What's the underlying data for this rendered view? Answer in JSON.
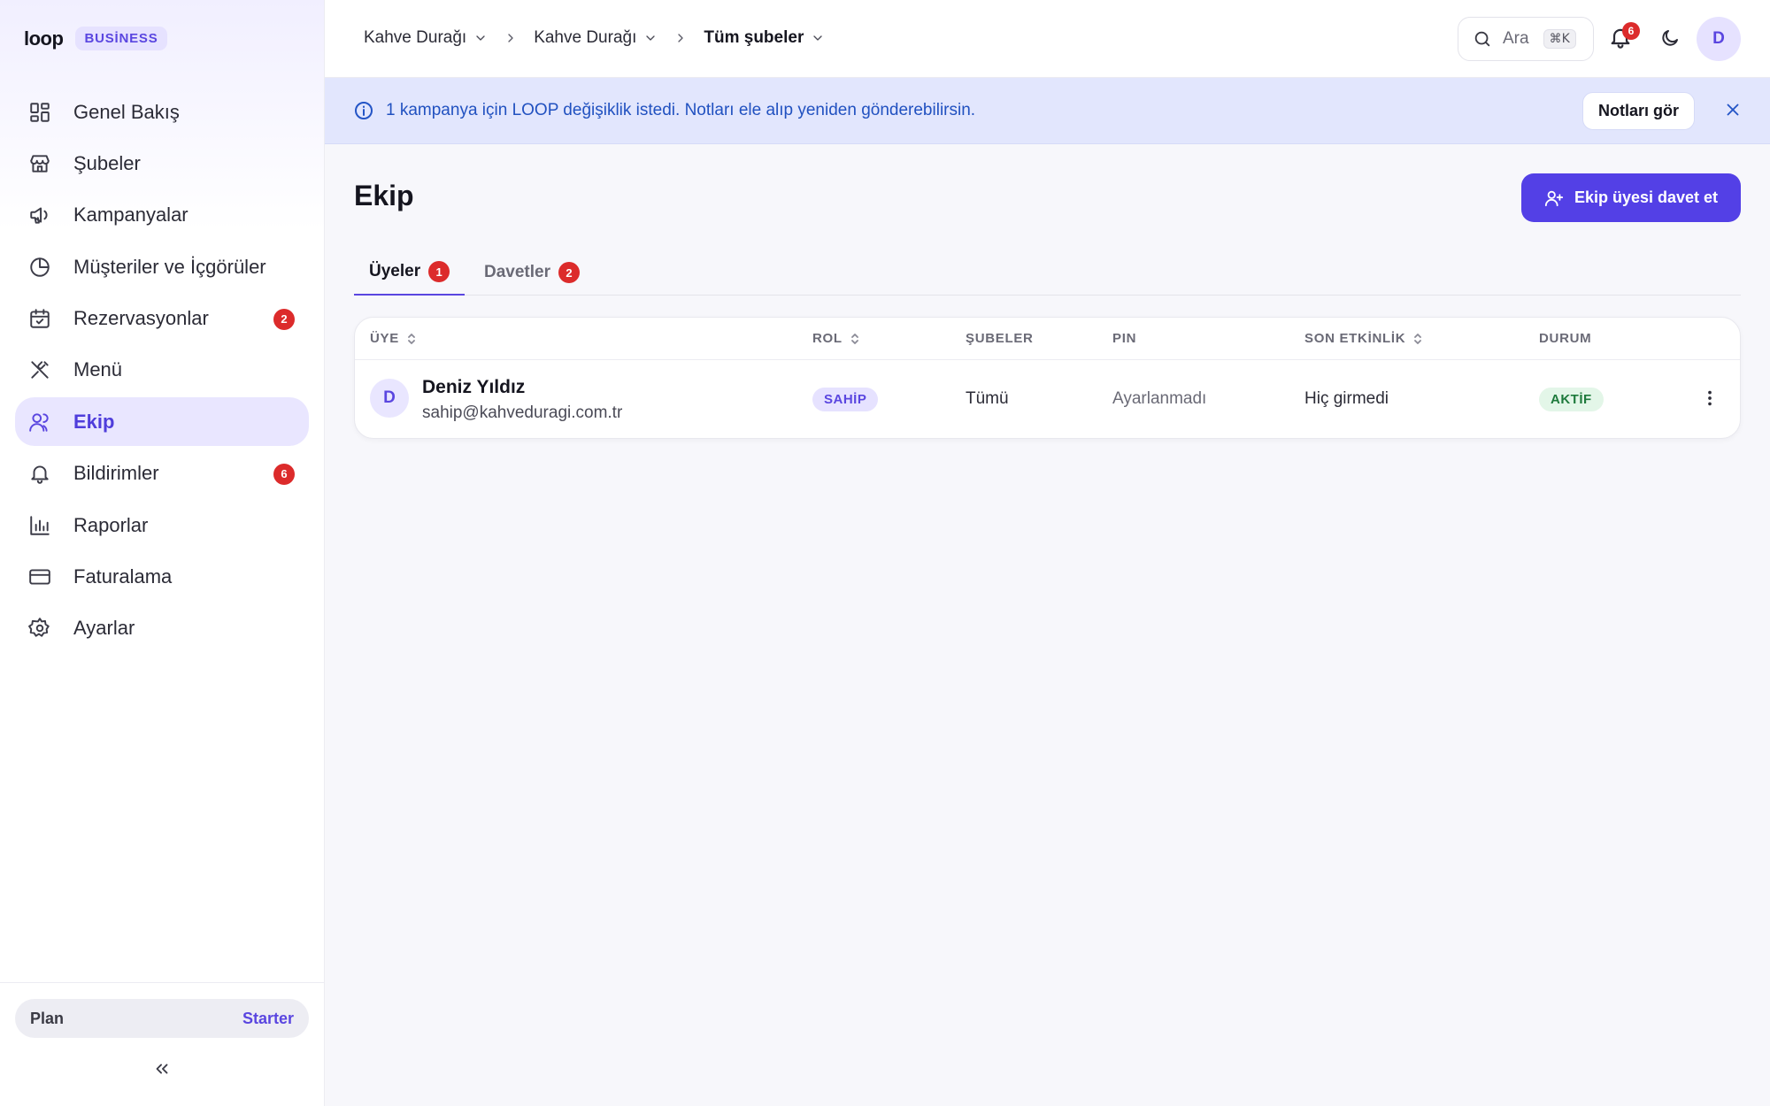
{
  "brand": {
    "logo": "loop",
    "badge": "BUSİNESS"
  },
  "sidebar": {
    "items": [
      {
        "label": "Genel Bakış",
        "icon": "dashboard-icon",
        "active": false,
        "count": ""
      },
      {
        "label": "Şubeler",
        "icon": "store-icon",
        "active": false,
        "count": ""
      },
      {
        "label": "Kampanyalar",
        "icon": "megaphone-icon",
        "active": false,
        "count": ""
      },
      {
        "label": "Müşteriler ve İçgörüler",
        "icon": "pie-chart-icon",
        "active": false,
        "count": ""
      },
      {
        "label": "Rezervasyonlar",
        "icon": "calendar-check-icon",
        "active": false,
        "count": "2"
      },
      {
        "label": "Menü",
        "icon": "utensils-icon",
        "active": false,
        "count": ""
      },
      {
        "label": "Ekip",
        "icon": "users-icon",
        "active": true,
        "count": ""
      },
      {
        "label": "Bildirimler",
        "icon": "bell-icon",
        "active": false,
        "count": "6"
      },
      {
        "label": "Raporlar",
        "icon": "bar-chart-icon",
        "active": false,
        "count": ""
      },
      {
        "label": "Faturalama",
        "icon": "credit-card-icon",
        "active": false,
        "count": ""
      },
      {
        "label": "Ayarlar",
        "icon": "gear-icon",
        "active": false,
        "count": ""
      }
    ],
    "plan": {
      "label": "Plan",
      "value": "Starter"
    }
  },
  "topbar": {
    "breadcrumbs": [
      "Kahve Durağı",
      "Kahve Durağı",
      "Tüm şubeler"
    ],
    "search": {
      "placeholder": "Ara",
      "shortcut": "⌘K"
    },
    "notification_count": "6",
    "avatar_initial": "D"
  },
  "banner": {
    "message": "1 kampanya için LOOP değişiklik istedi. Notları ele alıp yeniden gönderebilirsin.",
    "action_label": "Notları gör"
  },
  "main": {
    "title": "Ekip",
    "invite_label": "Ekip üyesi davet et",
    "tabs": [
      {
        "label": "Üyeler",
        "count": "1",
        "active": true
      },
      {
        "label": "Davetler",
        "count": "2",
        "active": false
      }
    ],
    "table": {
      "columns": [
        "ÜYE",
        "ROL",
        "ŞUBELER",
        "PIN",
        "SON ETKİNLİK",
        "DURUM"
      ],
      "rows": [
        {
          "initial": "D",
          "name": "Deniz Yıldız",
          "email": "sahip@kahveduragi.com.tr",
          "role": "SAHİP",
          "branches": "Tümü",
          "pin": "Ayarlanmadı",
          "last_activity": "Hiç girmedi",
          "status": "AKTİF"
        }
      ]
    }
  },
  "colors": {
    "accent": "#5340e6",
    "badge_red": "#dc2b2b",
    "banner_bg": "#e2e6fd",
    "banner_text": "#2151c0",
    "status_green": "#1e7a3c"
  }
}
